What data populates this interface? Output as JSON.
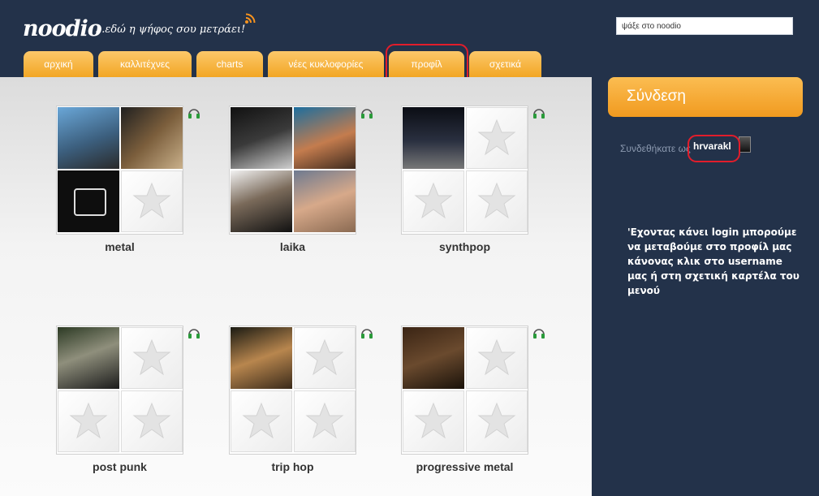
{
  "header": {
    "logo": "noodio",
    "tagline": "...εδώ η ψήφος σου μετράει!",
    "rss_icon": "rss-icon",
    "search": {
      "value": "ψάξε στο noodio"
    }
  },
  "nav": {
    "tabs": [
      {
        "label": "αρχική"
      },
      {
        "label": "καλλιτέχνες"
      },
      {
        "label": "charts"
      },
      {
        "label": "νέες κυκλοφορίες"
      },
      {
        "label": "προφίλ",
        "highlighted": true
      },
      {
        "label": "σχετικά"
      }
    ]
  },
  "genres": [
    {
      "name": "metal",
      "tiles": [
        "photo",
        "photo",
        "photo",
        "empty"
      ]
    },
    {
      "name": "laika",
      "tiles": [
        "photo",
        "photo",
        "photo",
        "photo"
      ]
    },
    {
      "name": "synthpop",
      "tiles": [
        "photo",
        "empty",
        "empty",
        "empty"
      ]
    },
    {
      "name": "post punk",
      "tiles": [
        "photo",
        "empty",
        "empty",
        "empty"
      ]
    },
    {
      "name": "trip hop",
      "tiles": [
        "photo",
        "empty",
        "empty",
        "empty"
      ]
    },
    {
      "name": "progressive metal",
      "tiles": [
        "photo",
        "empty",
        "empty",
        "empty"
      ]
    }
  ],
  "sidebar": {
    "login_button": "Σύνδεση",
    "logged_in_label": "Συνδεθήκατε ως",
    "username": "hrvarakl",
    "note": "'Εχοντας κάνει login μπορούμε να μεταβούμε στο προφίλ μας κάνονας κλικ στο username μας ή στη σχετική καρτέλα του μενού"
  },
  "colors": {
    "background": "#23324a",
    "tab_orange": "#f2a624",
    "highlight_red": "#e21d2b",
    "headphone_green": "#2a9a3a"
  }
}
